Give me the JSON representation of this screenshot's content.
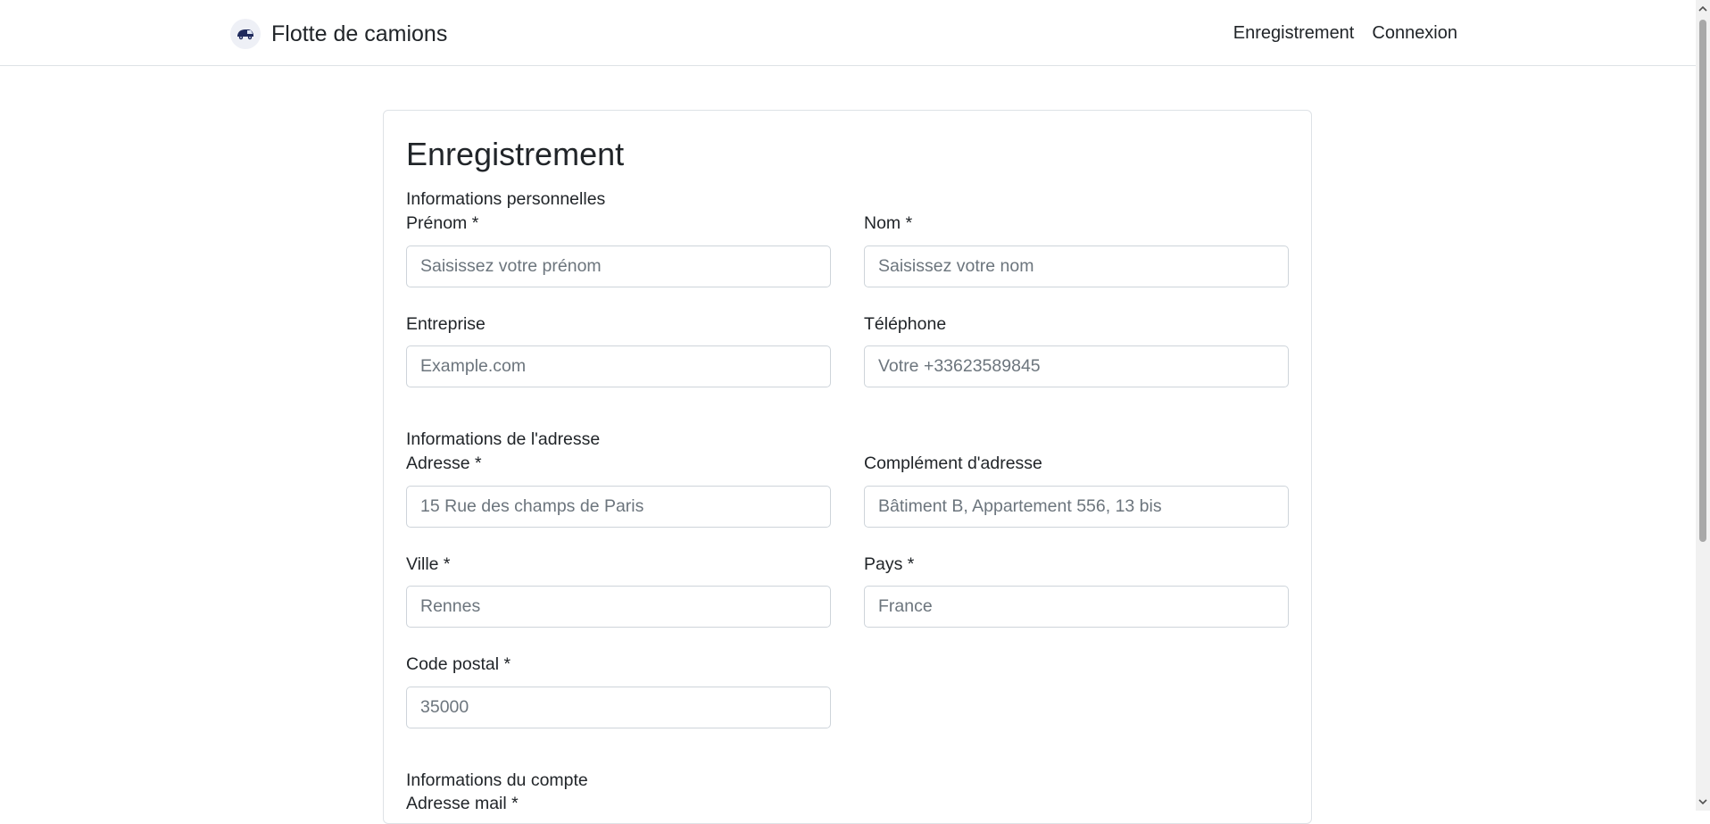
{
  "header": {
    "brand": "Flotte de camions",
    "links": [
      "Enregistrement",
      "Connexion"
    ]
  },
  "form": {
    "title": "Enregistrement",
    "personal": {
      "section": "Informations personnelles",
      "firstname_label": "Prénom *",
      "firstname_placeholder": "Saisissez votre prénom",
      "lastname_label": "Nom *",
      "lastname_placeholder": "Saisissez votre nom",
      "company_label": "Entreprise",
      "company_placeholder": "Example.com",
      "phone_label": "Téléphone",
      "phone_placeholder": "Votre +33623589845"
    },
    "address": {
      "section": "Informations de l'adresse",
      "address_label": "Adresse *",
      "address_placeholder": "15 Rue des champs de Paris",
      "complement_label": "Complément d'adresse",
      "complement_placeholder": "Bâtiment B, Appartement 556, 13 bis",
      "city_label": "Ville *",
      "city_placeholder": "Rennes",
      "country_label": "Pays *",
      "country_placeholder": "France",
      "postal_label": "Code postal *",
      "postal_placeholder": "35000"
    },
    "account": {
      "section": "Informations du compte",
      "email_label": "Adresse mail *"
    }
  },
  "icons": {
    "logo": "truck-logo-icon",
    "scroll_up": "chevron-up-icon",
    "scroll_down": "chevron-down-icon"
  }
}
